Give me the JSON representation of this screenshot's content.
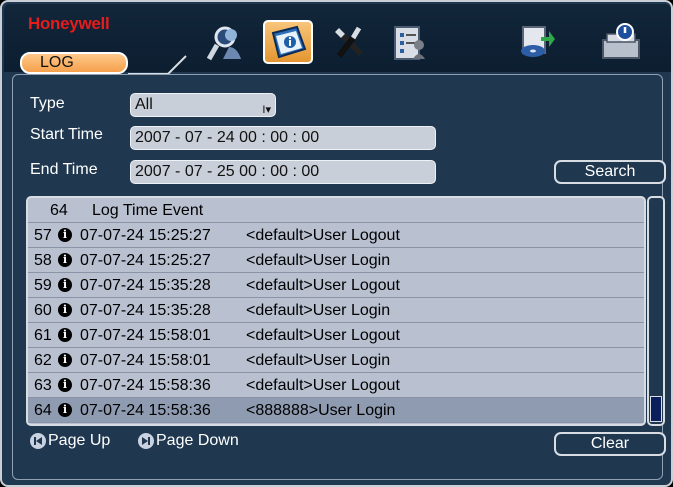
{
  "brand": "Honeywell",
  "active_tab": "LOG",
  "nav_icons": [
    "search-user-icon",
    "info-icon",
    "tools-icon",
    "clipboard-user-icon",
    "backup-disk-icon",
    "shutdown-icon"
  ],
  "form": {
    "type_label": "Type",
    "type_value": "All",
    "start_label": "Start Time",
    "start_value": "2007  - 07 - 24    00 : 00 : 00",
    "end_label": "End Time",
    "end_value": "2007  - 07 - 25    00 : 00 : 00",
    "search_label": "Search"
  },
  "log": {
    "header_count": "64",
    "header_text": "Log Time Event",
    "rows": [
      {
        "num": "57",
        "time": "07-07-24 15:25:27",
        "event": "<default>User Logout"
      },
      {
        "num": "58",
        "time": "07-07-24 15:25:27",
        "event": "<default>User Login"
      },
      {
        "num": "59",
        "time": "07-07-24 15:35:28",
        "event": "<default>User Logout"
      },
      {
        "num": "60",
        "time": "07-07-24 15:35:28",
        "event": "<default>User Login"
      },
      {
        "num": "61",
        "time": "07-07-24 15:58:01",
        "event": "<default>User Logout"
      },
      {
        "num": "62",
        "time": "07-07-24 15:58:01",
        "event": "<default>User Login"
      },
      {
        "num": "63",
        "time": "07-07-24 15:58:36",
        "event": "<default>User Logout"
      },
      {
        "num": "64",
        "time": "07-07-24 15:58:36",
        "event": "<888888>User Login"
      }
    ],
    "selected_row": 7
  },
  "footer": {
    "page_up": "Page Up",
    "page_down": "Page Down",
    "clear_label": "Clear"
  },
  "colors": {
    "brand": "#e61b1b",
    "background": "#1f3850",
    "list_bg": "#b9c1d1",
    "active_tab": "#f5a04c"
  }
}
